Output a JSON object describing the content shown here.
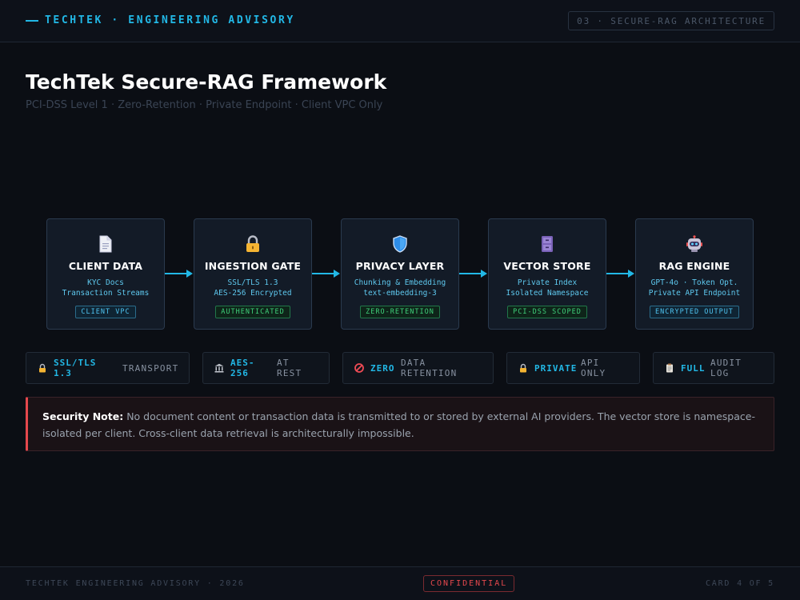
{
  "header": {
    "brand": "TECHTEK · ENGINEERING ADVISORY",
    "section": "03 · SECURE-RAG ARCHITECTURE"
  },
  "title": "TechTek Secure-RAG Framework",
  "subtitle": "PCI-DSS Level 1 · Zero-Retention · Private Endpoint · Client VPC Only",
  "flow": {
    "nodes": [
      {
        "icon": "document-icon",
        "title": "CLIENT DATA",
        "lines": [
          "KYC Docs",
          "Transaction Streams"
        ],
        "badge": "CLIENT VPC",
        "badge_color": "#4fc3f0"
      },
      {
        "icon": "lock-icon",
        "title": "INGESTION GATE",
        "lines": [
          "SSL/TLS 1.3",
          "AES-256 Encrypted"
        ],
        "badge": "AUTHENTICATED",
        "badge_color": "#3fd07a"
      },
      {
        "icon": "shield-icon",
        "title": "PRIVACY LAYER",
        "lines": [
          "Chunking & Embedding",
          "text-embedding-3"
        ],
        "badge": "ZERO-RETENTION",
        "badge_color": "#3fd07a"
      },
      {
        "icon": "file-cabinet-icon",
        "title": "VECTOR STORE",
        "lines": [
          "Private Index",
          "Isolated Namespace"
        ],
        "badge": "PCI-DSS SCOPED",
        "badge_color": "#3fd07a"
      },
      {
        "icon": "robot-icon",
        "title": "RAG ENGINE",
        "lines": [
          "GPT-4o · Token Opt.",
          "Private API Endpoint"
        ],
        "badge": "ENCRYPTED OUTPUT",
        "badge_color": "#4fc3f0"
      }
    ],
    "arrow_color": "#22b8e6"
  },
  "stats": [
    {
      "icon": "lock-icon",
      "value": [
        "SSL/TLS",
        "1.3"
      ],
      "label": [
        "TRANSPORT"
      ]
    },
    {
      "icon": "bank-icon",
      "value": [
        "AES-",
        "256"
      ],
      "label": [
        "AT",
        "REST"
      ]
    },
    {
      "icon": "no-entry-icon",
      "value": [
        "ZERO"
      ],
      "label": [
        "DATA",
        "RETENTION"
      ]
    },
    {
      "icon": "lock-icon",
      "value": [
        "PRIVATE"
      ],
      "label": [
        "API",
        "ONLY"
      ]
    },
    {
      "icon": "clipboard-icon",
      "value": [
        "FULL"
      ],
      "label": [
        "AUDIT",
        "LOG"
      ]
    }
  ],
  "note": {
    "lead": "Security Note:",
    "text": "No document content or transaction data is transmitted to or stored by external AI providers. The vector store is namespace-isolated per client. Cross-client data retrieval is architecturally impossible.",
    "accent": "#e5484d"
  },
  "footer": {
    "left": "TECHTEK ENGINEERING ADVISORY · 2026",
    "badge": "CONFIDENTIAL",
    "right": "CARD 4 OF 5"
  }
}
